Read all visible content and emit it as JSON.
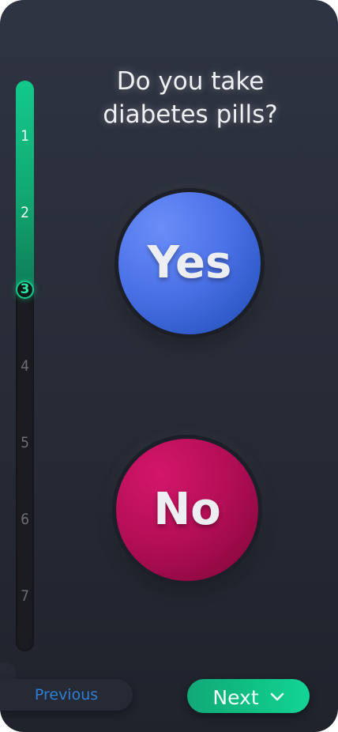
{
  "question": {
    "text": "Do you take diabetes pills?"
  },
  "progress": {
    "current_step": 3,
    "total_steps": 7,
    "steps": [
      "1",
      "2",
      "3",
      "4",
      "5",
      "6",
      "7"
    ],
    "fill_color": "#12c98b",
    "track_color": "#1b1c20"
  },
  "answers": {
    "yes_label": "Yes",
    "no_label": "No",
    "yes_color": "#4c72e8",
    "no_color": "#b20e55"
  },
  "navigation": {
    "previous_label": "Previous",
    "next_label": "Next",
    "next_icon": "chevron-down-icon",
    "previous_color": "#2f7fd4",
    "next_color": "#12c98b"
  }
}
